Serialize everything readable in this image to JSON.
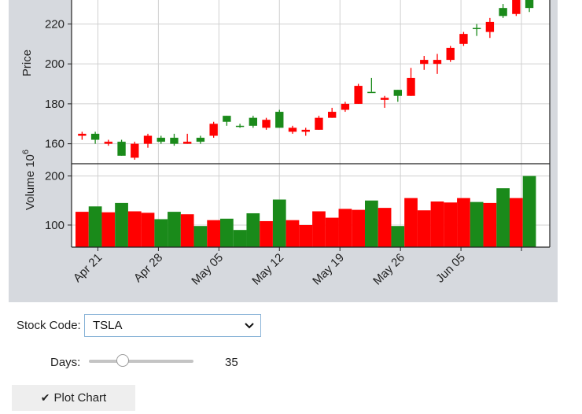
{
  "controls": {
    "stock_code_label": "Stock Code:",
    "stock_code_value": "TSLA",
    "days_label": "Days:",
    "days_value": "35",
    "days_fraction": 0.3,
    "plot_button_label": "Plot Chart"
  },
  "icons": {
    "dropdown": "chevron-down-icon",
    "plot": "check-icon"
  },
  "colors": {
    "up": "#1a8a1a",
    "down": "#ff0000",
    "panel_bg": "#d6d9de"
  },
  "chart_data": {
    "type": "candlestick",
    "price_ylabel": "Price",
    "price_ylim": [
      150,
      232
    ],
    "price_yticks": [
      160,
      180,
      200,
      220
    ],
    "volume_ylabel": "Volume",
    "volume_exponent": "6",
    "volume_ylim": [
      55,
      225
    ],
    "volume_yticks": [
      100,
      200
    ],
    "xtick_labels": [
      "Apr 21",
      "Apr 28",
      "May 05",
      "May 12",
      "May 19",
      "May 26",
      "Jun 05"
    ],
    "grid": true,
    "candles": [
      {
        "o": 165,
        "h": 166,
        "l": 162,
        "c": 164,
        "v": 127
      },
      {
        "o": 162,
        "h": 166,
        "l": 160,
        "c": 165,
        "v": 138
      },
      {
        "o": 161,
        "h": 162,
        "l": 159,
        "c": 160,
        "v": 126
      },
      {
        "o": 154,
        "h": 162,
        "l": 154,
        "c": 161,
        "v": 145
      },
      {
        "o": 160,
        "h": 161,
        "l": 152,
        "c": 153,
        "v": 128
      },
      {
        "o": 164,
        "h": 165,
        "l": 158,
        "c": 160,
        "v": 125
      },
      {
        "o": 161,
        "h": 164,
        "l": 160,
        "c": 163,
        "v": 112
      },
      {
        "o": 160,
        "h": 165,
        "l": 159,
        "c": 163,
        "v": 127
      },
      {
        "o": 161,
        "h": 165,
        "l": 160,
        "c": 160,
        "v": 122
      },
      {
        "o": 161,
        "h": 164,
        "l": 160,
        "c": 163,
        "v": 98
      },
      {
        "o": 170,
        "h": 171,
        "l": 163,
        "c": 164,
        "v": 110
      },
      {
        "o": 171,
        "h": 174,
        "l": 169,
        "c": 174,
        "v": 113
      },
      {
        "o": 169,
        "h": 170,
        "l": 168,
        "c": 169,
        "v": 90
      },
      {
        "o": 169,
        "h": 174,
        "l": 168,
        "c": 173,
        "v": 124
      },
      {
        "o": 172,
        "h": 173,
        "l": 167,
        "c": 168,
        "v": 108
      },
      {
        "o": 168,
        "h": 177,
        "l": 168,
        "c": 176,
        "v": 152
      },
      {
        "o": 168,
        "h": 169,
        "l": 165,
        "c": 166,
        "v": 110
      },
      {
        "o": 167,
        "h": 168,
        "l": 164,
        "c": 166,
        "v": 100
      },
      {
        "o": 173,
        "h": 174,
        "l": 167,
        "c": 167,
        "v": 128
      },
      {
        "o": 176,
        "h": 178,
        "l": 173,
        "c": 173,
        "v": 115
      },
      {
        "o": 180,
        "h": 181,
        "l": 176,
        "c": 177,
        "v": 133
      },
      {
        "o": 189,
        "h": 190,
        "l": 180,
        "c": 180,
        "v": 131
      },
      {
        "o": 186,
        "h": 193,
        "l": 186,
        "c": 186,
        "v": 150
      },
      {
        "o": 183,
        "h": 184,
        "l": 178,
        "c": 182,
        "v": 135
      },
      {
        "o": 184,
        "h": 187,
        "l": 181,
        "c": 187,
        "v": 98
      },
      {
        "o": 193,
        "h": 198,
        "l": 184,
        "c": 184,
        "v": 155
      },
      {
        "o": 202,
        "h": 204,
        "l": 197,
        "c": 200,
        "v": 130
      },
      {
        "o": 202,
        "h": 205,
        "l": 195,
        "c": 200,
        "v": 148
      },
      {
        "o": 208,
        "h": 209,
        "l": 201,
        "c": 202,
        "v": 146
      },
      {
        "o": 215,
        "h": 216,
        "l": 209,
        "c": 210,
        "v": 155
      },
      {
        "o": 218,
        "h": 220,
        "l": 214,
        "c": 218,
        "v": 147
      },
      {
        "o": 221,
        "h": 223,
        "l": 213,
        "c": 216,
        "v": 145
      },
      {
        "o": 224,
        "h": 230,
        "l": 223,
        "c": 228,
        "v": 175
      },
      {
        "o": 234,
        "h": 236,
        "l": 224,
        "c": 225,
        "v": 155
      },
      {
        "o": 228,
        "h": 235,
        "l": 226,
        "c": 233,
        "v": 200
      }
    ]
  }
}
